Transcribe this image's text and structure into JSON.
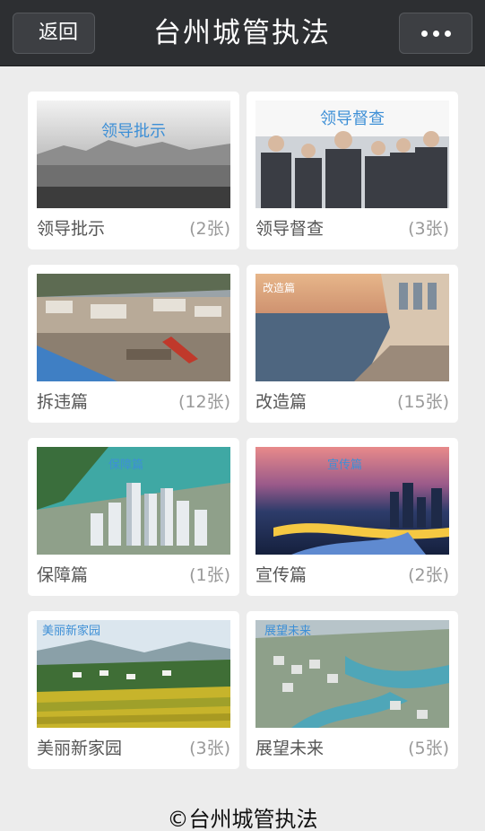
{
  "header": {
    "back_label": "返回",
    "title": "台州城管执法",
    "more_icon": "more-dots-icon"
  },
  "gallery": {
    "items": [
      {
        "label": "领导批示",
        "count": "(2张)",
        "overlay": "领导批示"
      },
      {
        "label": "领导督查",
        "count": "(3张)",
        "overlay": "领导督查"
      },
      {
        "label": "拆违篇",
        "count": "(12张)",
        "overlay": ""
      },
      {
        "label": "改造篇",
        "count": "(15张)",
        "overlay": "改造篇"
      },
      {
        "label": "保障篇",
        "count": "(1张)",
        "overlay": "保障篇"
      },
      {
        "label": "宣传篇",
        "count": "(2张)",
        "overlay": "宣传篇"
      },
      {
        "label": "美丽新家园",
        "count": "(3张)",
        "overlay": "美丽新家园"
      },
      {
        "label": "展望未来",
        "count": "(5张)",
        "overlay": "展望未来"
      }
    ]
  },
  "footer": {
    "copyright": "©台州城管执法"
  },
  "colors": {
    "topbar": "#2d2f32",
    "background": "#ececec",
    "overlay_blue": "#3d8fd6"
  }
}
